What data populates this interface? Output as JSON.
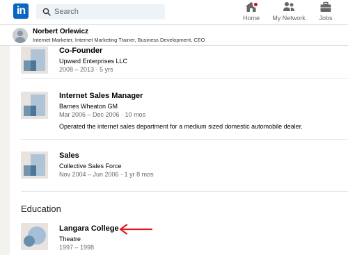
{
  "nav": {
    "logo_text": "in",
    "search_placeholder": "Search",
    "items": [
      {
        "label": "Home",
        "icon": "home-icon"
      },
      {
        "label": "My Network",
        "icon": "network-icon"
      },
      {
        "label": "Jobs",
        "icon": "briefcase-icon"
      }
    ],
    "notification_color": "#cc1016",
    "brand_color": "#0a66c2"
  },
  "profile": {
    "name": "Norbert Orlewicz",
    "headline": "Internet Marketer, Internet Marketing Trainer, Business Development, CEO"
  },
  "experience": [
    {
      "title": "Co-Founder",
      "company": "Upward Enterprises LLC",
      "dates": "2008 – 2013 · 5 yrs",
      "description": ""
    },
    {
      "title": "Internet Sales Manager",
      "company": "Barnes Wheaton GM",
      "dates": "Mar 2006 – Dec 2006 · 10 mos",
      "description": "Operated the internet sales department for a medium sized domestic automobile dealer."
    },
    {
      "title": "Sales",
      "company": "Collective Sales Force",
      "dates": "Nov 2004 – Jun 2006 · 1 yr 8 mos",
      "description": ""
    }
  ],
  "education": {
    "section_title": "Education",
    "items": [
      {
        "school": "Langara College",
        "field": "Theatre",
        "dates": "1997 – 1998"
      }
    ]
  },
  "annotation": {
    "arrow_color": "#e0171f"
  }
}
